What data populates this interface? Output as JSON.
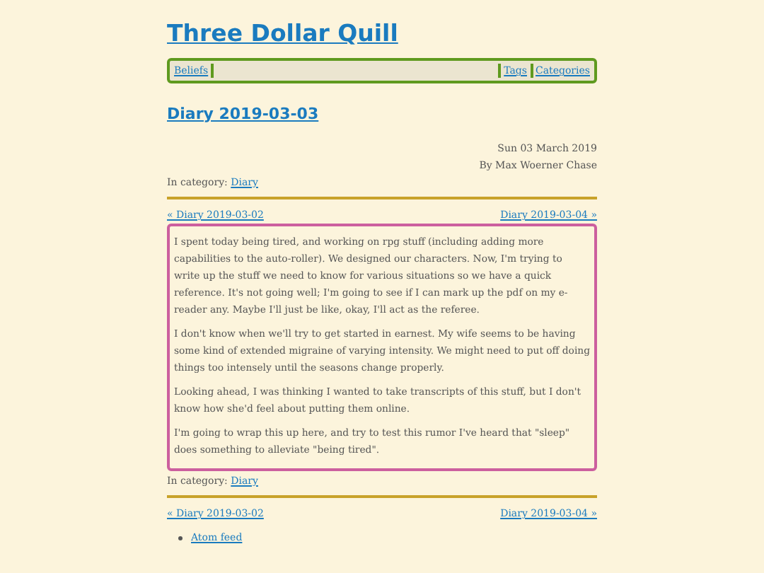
{
  "site_title": "Three Dollar Quill",
  "nav": {
    "left": [
      {
        "label": "Beliefs"
      }
    ],
    "right": [
      {
        "label": "Tags"
      },
      {
        "label": "Categories"
      }
    ]
  },
  "post": {
    "title": "Diary 2019-03-03",
    "date": "Sun 03 March 2019",
    "byline": "By Max Woerner Chase",
    "category_label": "In category:",
    "category": "Diary",
    "prev": "« Diary 2019-03-02",
    "next": "Diary 2019-03-04 »",
    "paragraphs": [
      "I spent today being tired, and working on rpg stuff (including adding more capabilities to the auto-roller). We designed our characters. Now, I'm trying to write up the stuff we need to know for various situations so we have a quick reference. It's not going well; I'm going to see if I can mark up the pdf on my e-reader any. Maybe I'll just be like, okay, I'll act as the referee.",
      "I don't know when we'll try to get started in earnest. My wife seems to be having some kind of extended migraine of varying intensity. We might need to put off doing things too intensely until the seasons change properly.",
      "Looking ahead, I was thinking I wanted to take transcripts of this stuff, but I don't know how she'd feel about putting them online.",
      "I'm going to wrap this up here, and try to test this rumor I've heard that \"sleep\" does something to alleviate \"being tired\"."
    ],
    "footer_category_label": "In category:",
    "footer_category": "Diary",
    "footer_prev": "« Diary 2019-03-02",
    "footer_next": "Diary 2019-03-04 »"
  },
  "feeds": [
    {
      "label": "Atom feed"
    }
  ]
}
